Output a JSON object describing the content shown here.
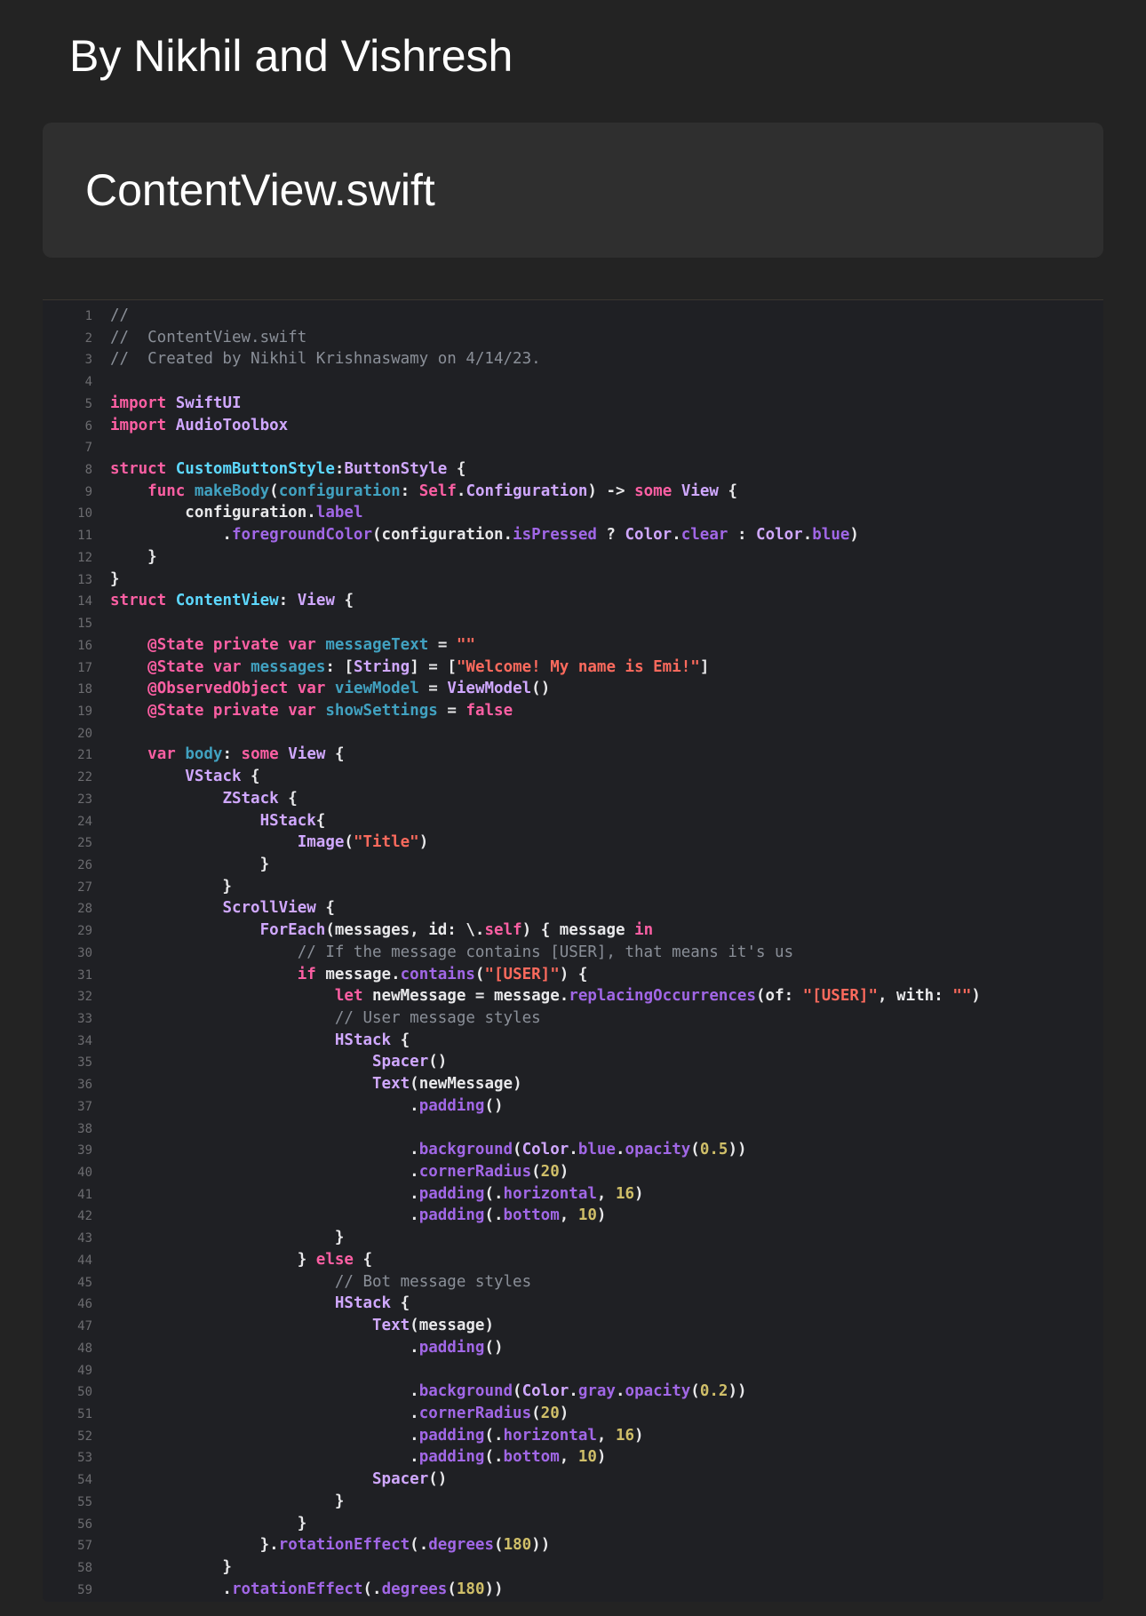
{
  "header": {
    "byline": "By Nikhil and Vishresh"
  },
  "file": {
    "title": "ContentView.swift"
  },
  "code": {
    "lines": [
      {
        "n": "1",
        "text": "//"
      },
      {
        "n": "2",
        "text": "//  ContentView.swift"
      },
      {
        "n": "3",
        "text": "//  Created by Nikhil Krishnaswamy on 4/14/23."
      },
      {
        "n": "4",
        "text": ""
      },
      {
        "n": "5",
        "text": "import SwiftUI"
      },
      {
        "n": "6",
        "text": "import AudioToolbox"
      },
      {
        "n": "7",
        "text": ""
      },
      {
        "n": "8",
        "text": "struct CustomButtonStyle:ButtonStyle {"
      },
      {
        "n": "9",
        "text": "    func makeBody(configuration: Self.Configuration) -> some View {"
      },
      {
        "n": "10",
        "text": "        configuration.label"
      },
      {
        "n": "11",
        "text": "            .foregroundColor(configuration.isPressed ? Color.clear : Color.blue)"
      },
      {
        "n": "12",
        "text": "    }"
      },
      {
        "n": "13",
        "text": "}"
      },
      {
        "n": "14",
        "text": "struct ContentView: View {"
      },
      {
        "n": "15",
        "text": ""
      },
      {
        "n": "16",
        "text": "    @State private var messageText = \"\""
      },
      {
        "n": "17",
        "text": "    @State var messages: [String] = [\"Welcome! My name is Emi!\"]"
      },
      {
        "n": "18",
        "text": "    @ObservedObject var viewModel = ViewModel()"
      },
      {
        "n": "19",
        "text": "    @State private var showSettings = false"
      },
      {
        "n": "20",
        "text": ""
      },
      {
        "n": "21",
        "text": "    var body: some View {"
      },
      {
        "n": "22",
        "text": "        VStack {"
      },
      {
        "n": "23",
        "text": "            ZStack {"
      },
      {
        "n": "24",
        "text": "                HStack{"
      },
      {
        "n": "25",
        "text": "                    Image(\"Title\")"
      },
      {
        "n": "26",
        "text": "                }"
      },
      {
        "n": "27",
        "text": "            }"
      },
      {
        "n": "28",
        "text": "            ScrollView {"
      },
      {
        "n": "29",
        "text": "                ForEach(messages, id: \\.self) { message in"
      },
      {
        "n": "30",
        "text": "                    // If the message contains [USER], that means it's us"
      },
      {
        "n": "31",
        "text": "                    if message.contains(\"[USER]\") {"
      },
      {
        "n": "32",
        "text": "                        let newMessage = message.replacingOccurrences(of: \"[USER]\", with: \"\")"
      },
      {
        "n": "33",
        "text": "                        // User message styles"
      },
      {
        "n": "34",
        "text": "                        HStack {"
      },
      {
        "n": "35",
        "text": "                            Spacer()"
      },
      {
        "n": "36",
        "text": "                            Text(newMessage)"
      },
      {
        "n": "37",
        "text": "                                .padding()"
      },
      {
        "n": "38",
        "text": ""
      },
      {
        "n": "39",
        "text": "                                .background(Color.blue.opacity(0.5))"
      },
      {
        "n": "40",
        "text": "                                .cornerRadius(20)"
      },
      {
        "n": "41",
        "text": "                                .padding(.horizontal, 16)"
      },
      {
        "n": "42",
        "text": "                                .padding(.bottom, 10)"
      },
      {
        "n": "43",
        "text": "                        }"
      },
      {
        "n": "44",
        "text": "                    } else {"
      },
      {
        "n": "45",
        "text": "                        // Bot message styles"
      },
      {
        "n": "46",
        "text": "                        HStack {"
      },
      {
        "n": "47",
        "text": "                            Text(message)"
      },
      {
        "n": "48",
        "text": "                                .padding()"
      },
      {
        "n": "49",
        "text": ""
      },
      {
        "n": "50",
        "text": "                                .background(Color.gray.opacity(0.2))"
      },
      {
        "n": "51",
        "text": "                                .cornerRadius(20)"
      },
      {
        "n": "52",
        "text": "                                .padding(.horizontal, 16)"
      },
      {
        "n": "53",
        "text": "                                .padding(.bottom, 10)"
      },
      {
        "n": "54",
        "text": "                            Spacer()"
      },
      {
        "n": "55",
        "text": "                        }"
      },
      {
        "n": "56",
        "text": "                    }"
      },
      {
        "n": "57",
        "text": "                }.rotationEffect(.degrees(180))"
      },
      {
        "n": "58",
        "text": "            }"
      },
      {
        "n": "59",
        "text": "            .rotationEffect(.degrees(180))"
      }
    ]
  },
  "theme": {
    "page_background": "#232323",
    "card_background": "#2f2f2f",
    "code_background": "#1f2024",
    "keyword_color": "#fc5fa3",
    "string_color": "#fc6a5d",
    "number_color": "#d0bf69",
    "comment_color": "#8a8f98",
    "function_color": "#a167e6",
    "declaration_color": "#5dd8ff"
  }
}
